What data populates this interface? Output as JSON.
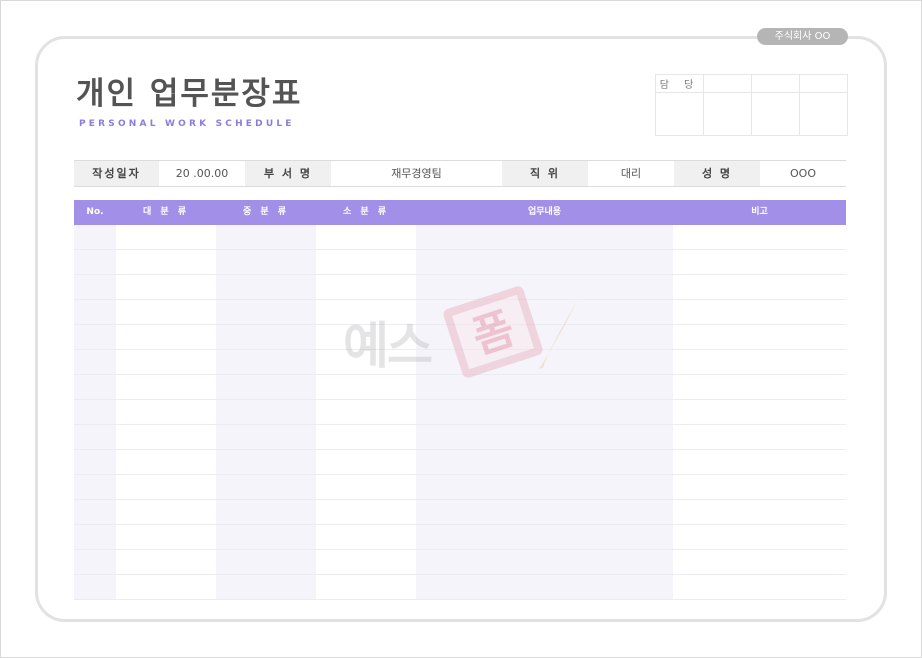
{
  "company_badge": "주식회사 OO",
  "title": "개인 업무분장표",
  "subtitle": "PERSONAL WORK SCHEDULE",
  "approval": {
    "label": "담 당"
  },
  "info": [
    {
      "key": "작성일자",
      "value": "20   .00.00"
    },
    {
      "key": "부 서 명",
      "value": "재무경영팀"
    },
    {
      "key": "직 위",
      "value": "대리"
    },
    {
      "key": "성 명",
      "value": "OOO"
    }
  ],
  "table": {
    "headers": [
      "No.",
      "대 분 류",
      "중 분 류",
      "소 분 류",
      "업무내용",
      "비고"
    ],
    "row_count": 15
  },
  "watermark": {
    "text": "예스",
    "stamp_text": "폼"
  },
  "colors": {
    "accent": "#a18fe8",
    "subtitle": "#8c7cdc",
    "shade": "#f5f4fb"
  }
}
